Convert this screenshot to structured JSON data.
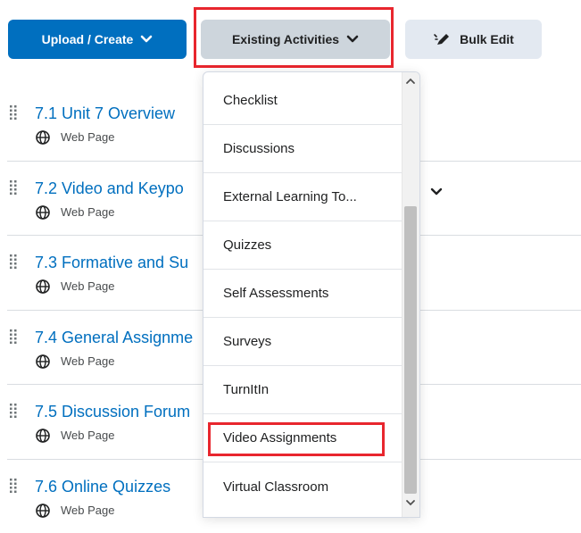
{
  "toolbar": {
    "upload_label": "Upload / Create",
    "existing_label": "Existing Activities",
    "bulk_label": "Bulk Edit"
  },
  "items": [
    {
      "title": "7.1 Unit 7 Overview",
      "type": "Web Page"
    },
    {
      "title": "7.2 Video and Keypo",
      "type": "Web Page"
    },
    {
      "title": "7.3 Formative and Su",
      "type": "Web Page"
    },
    {
      "title": "7.4 General Assignme",
      "type": "Web Page"
    },
    {
      "title": "7.5 Discussion Forum",
      "type": "Web Page"
    },
    {
      "title": "7.6 Online Quizzes",
      "type": "Web Page"
    }
  ],
  "dropdown": {
    "options": [
      "Checklist",
      "Discussions",
      "External Learning To...",
      "Quizzes",
      "Self Assessments",
      "Surveys",
      "TurnItIn",
      "Video Assignments",
      "Virtual Classroom"
    ]
  },
  "colors": {
    "primary": "#006fbf",
    "highlight": "#e8262e"
  }
}
